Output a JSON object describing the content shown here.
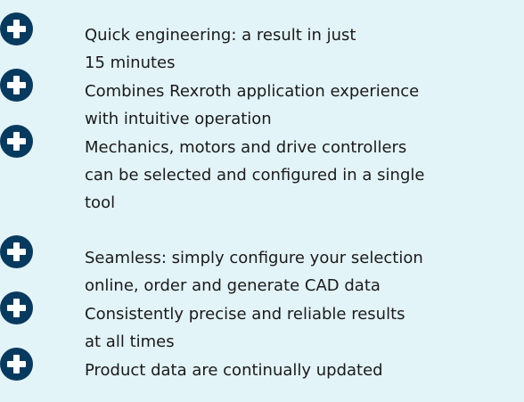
{
  "features": [
    {
      "icon": "plus-circle-icon",
      "text": "Quick engineering: a result in just\n15 minutes"
    },
    {
      "icon": "plus-circle-icon",
      "text": "Combines Rexroth application experience\nwith intuitive operation"
    },
    {
      "icon": "plus-circle-icon",
      "text": "Mechanics, motors and drive controllers\ncan be selected and configured in a single\ntool"
    },
    {
      "icon": "plus-circle-icon",
      "text": "Seamless: simply configure your selection\nonline, order and generate CAD data"
    },
    {
      "icon": "plus-circle-icon",
      "text": "Consistently precise and reliable results\nat all times"
    },
    {
      "icon": "plus-circle-icon",
      "text": "Product data are continually updated"
    }
  ],
  "colors": {
    "background": "#e3f4f9",
    "icon": "#083a5f",
    "text": "#1a1a1a"
  }
}
